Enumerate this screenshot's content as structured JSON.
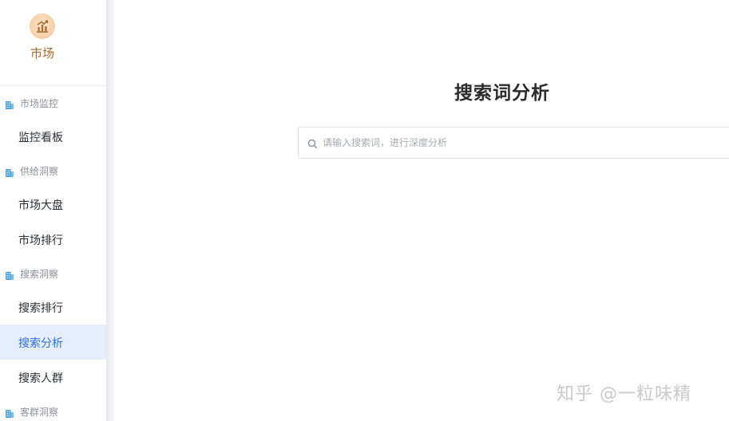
{
  "brand": {
    "title": "市场",
    "icon": "bar-chart-icon"
  },
  "sidebar": {
    "groups": [
      {
        "label": "市场监控",
        "icon": "building-icon"
      },
      {
        "label": "供给洞察",
        "icon": "building-icon"
      },
      {
        "label": "搜索洞察",
        "icon": "building-icon"
      },
      {
        "label": "客群洞察",
        "icon": "building-icon"
      }
    ],
    "items": [
      {
        "label": "监控看板",
        "group": 0,
        "active": false
      },
      {
        "label": "市场大盘",
        "group": 1,
        "active": false
      },
      {
        "label": "市场排行",
        "group": 1,
        "active": false
      },
      {
        "label": "搜索排行",
        "group": 2,
        "active": false
      },
      {
        "label": "搜索分析",
        "group": 2,
        "active": true
      },
      {
        "label": "搜索人群",
        "group": 2,
        "active": false
      }
    ]
  },
  "main": {
    "title": "搜索词分析",
    "search": {
      "placeholder": "请输入搜索词，进行深度分析",
      "value": ""
    }
  },
  "watermark": {
    "text": "知乎 @一粒味精"
  },
  "colors": {
    "accent": "#2f6fd8",
    "active_bg": "#e6eefb",
    "brand": "#a46a2e",
    "group_icon": "#4a9fd8"
  }
}
